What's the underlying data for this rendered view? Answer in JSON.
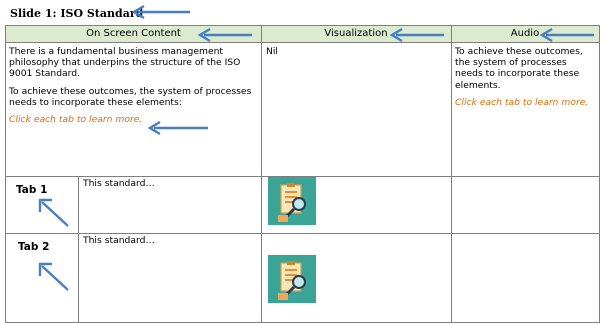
{
  "slide": {
    "title": "Slide 1: ISO Standard"
  },
  "table": {
    "headers": {
      "on_screen": "On Screen Content",
      "visualization": "Visualization",
      "audio": "Audio"
    },
    "main_row": {
      "on_screen_p1": "There is a fundamental business management philosophy that underpins the structure of the ISO 9001 Standard.",
      "on_screen_p2": "To achieve these outcomes, the system of processes needs to incorporate these elements:",
      "on_screen_cta": "Click each tab to learn more.",
      "visualization": "Nil",
      "audio_p1": "To achieve these outcomes, the system of processes needs to incorporate these elements.",
      "audio_cta": "Click each tab to learn more."
    },
    "tabs": [
      {
        "label": "Tab 1",
        "content": "This standard…"
      },
      {
        "label": "Tab 2",
        "content": "This standard…"
      }
    ]
  },
  "colors": {
    "header_bg": "#dcebd0",
    "accent_orange": "#e36c09",
    "arrow_blue": "#4a7ec2",
    "thumb_bg": "#3aa596"
  },
  "icons": [
    "arrow-icon",
    "checklist-magnifier-icon"
  ]
}
